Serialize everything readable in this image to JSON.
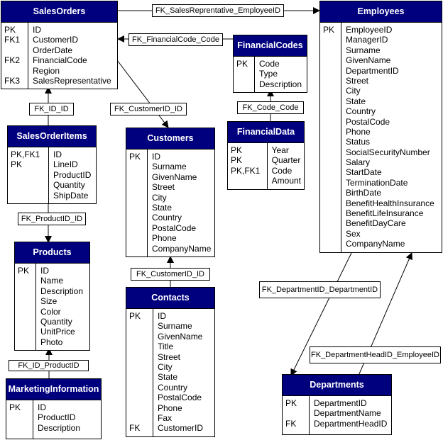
{
  "diagram": {
    "colors": {
      "header": "#00007f",
      "header_text": "#ffffff",
      "line": "#000000"
    },
    "entities": {
      "sales_orders": {
        "title": "SalesOrders",
        "keys": [
          "PK",
          "FK1",
          "",
          "FK2",
          "",
          "FK3"
        ],
        "columns": [
          "ID",
          "CustomerID",
          "OrderDate",
          "FinancialCode",
          "Region",
          "SalesRepresentative"
        ]
      },
      "employees": {
        "title": "Employees",
        "keys": [
          "PK"
        ],
        "columns": [
          "EmployeeID",
          "ManagerID",
          "Surname",
          "GivenName",
          "DepartmentID",
          "Street",
          "City",
          "State",
          "Country",
          "PostalCode",
          "Phone",
          "Status",
          "SocialSecurityNumber",
          "Salary",
          "StartDate",
          "TerminationDate",
          "BirthDate",
          "BenefitHealthInsurance",
          "BenefitLifeInsurance",
          "BenefitDayCare",
          "Sex",
          "CompanyName"
        ]
      },
      "financial_codes": {
        "title": "FinancialCodes",
        "keys": [
          "PK"
        ],
        "columns": [
          "Code",
          "Type",
          "Description"
        ]
      },
      "financial_data": {
        "title": "FinancialData",
        "keys": [
          "PK",
          "PK",
          "PK,FK1"
        ],
        "columns": [
          "Year",
          "Quarter",
          "Code",
          "Amount"
        ]
      },
      "sales_order_items": {
        "title": "SalesOrderItems",
        "keys": [
          "PK,FK1",
          "PK"
        ],
        "columns": [
          "ID",
          "LineID",
          "ProductID",
          "Quantity",
          "ShipDate"
        ]
      },
      "customers": {
        "title": "Customers",
        "keys": [
          "PK"
        ],
        "columns": [
          "ID",
          "Surname",
          "GivenName",
          "Street",
          "City",
          "State",
          "Country",
          "PostalCode",
          "Phone",
          "CompanyName"
        ]
      },
      "products": {
        "title": "Products",
        "keys": [
          "PK"
        ],
        "columns": [
          "ID",
          "Name",
          "Description",
          "Size",
          "Color",
          "Quantity",
          "UnitPrice",
          "Photo"
        ]
      },
      "contacts": {
        "title": "Contacts",
        "keys": [
          "PK",
          "",
          "",
          "",
          "",
          "",
          "",
          "",
          "",
          "",
          "",
          "FK"
        ],
        "columns": [
          "ID",
          "Surname",
          "GivenName",
          "Title",
          "Street",
          "City",
          "State",
          "Country",
          "PostalCode",
          "Phone",
          "Fax",
          "CustomerID"
        ]
      },
      "marketing_information": {
        "title": "MarketingInformation",
        "keys": [
          "PK"
        ],
        "columns": [
          "ID",
          "ProductID",
          "Description"
        ]
      },
      "departments": {
        "title": "Departments",
        "keys": [
          "PK",
          "",
          "FK"
        ],
        "columns": [
          "DepartmentID",
          "DepartmentName",
          "DepartmentHeadID"
        ]
      }
    },
    "relationships": {
      "fk_salesrep_employee": "FK_SalesReprentative_EmployeeID",
      "fk_financialcode_code": "FK_FinancialCode_Code",
      "fk_id_id": "FK_ID_ID",
      "fk_customerid_id_orders": "FK_CustomerID_ID",
      "fk_code_code": "FK_Code_Code",
      "fk_productid_id": "FK_ProductID_ID",
      "fk_customerid_id_contacts": "FK_CustomerID_ID",
      "fk_id_productid": "FK_ID_ProductID",
      "fk_departmentid_departmentid": "FK_DepartmentID_DepartmentID",
      "fk_departmentheadid_employeeid": "FK_DepartmentHeadID_EmployeeID"
    }
  }
}
